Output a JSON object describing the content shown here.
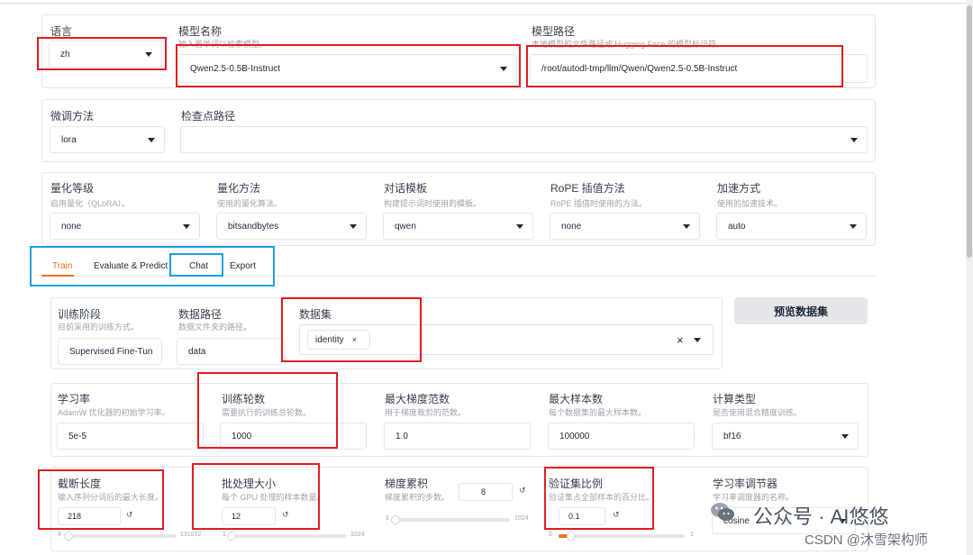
{
  "top": {
    "lang": {
      "label": "语言",
      "value": "zh"
    },
    "model_name": {
      "label": "模型名称",
      "hint": "输入首单词以检索模型。",
      "value": "Qwen2.5-0.5B-Instruct"
    },
    "model_path": {
      "label": "模型路径",
      "hint": "本地模型的文件路径或 Hugging Face 的模型标识符。",
      "value": "/root/autodl-tmp/llm/Qwen/Qwen2.5-0.5B-Instruct"
    }
  },
  "finetune": {
    "method": {
      "label": "微调方法",
      "value": "lora"
    },
    "checkpoint": {
      "label": "检查点路径",
      "value": ""
    }
  },
  "advanced": {
    "quant_bit": {
      "label": "量化等级",
      "hint": "启用量化（QLoRA）。",
      "value": "none"
    },
    "quant_method": {
      "label": "量化方法",
      "hint": "使用的量化算法。",
      "value": "bitsandbytes"
    },
    "template": {
      "label": "对话模板",
      "hint": "构建提示词时使用的模板。",
      "value": "qwen"
    },
    "rope": {
      "label": "RoPE 插值方法",
      "hint": "RoPE 插值时使用的方法。",
      "value": "none"
    },
    "booster": {
      "label": "加速方式",
      "hint": "使用的加速技术。",
      "value": "auto"
    }
  },
  "tabs": [
    "Train",
    "Evaluate & Predict",
    "Chat",
    "Export"
  ],
  "train": {
    "stage": {
      "label": "训练阶段",
      "hint": "目前采用的训练方式。",
      "value": "Supervised Fine-Tun"
    },
    "data_dir": {
      "label": "数据路径",
      "hint": "数据文件夹的路径。",
      "value": "data"
    },
    "dataset": {
      "label": "数据集",
      "chip": "identity",
      "chip_close": "×",
      "clear": "×"
    },
    "preview_button": "预览数据集",
    "learning_rate": {
      "label": "学习率",
      "hint": "AdamW 优化器的初始学习率。",
      "value": "5e-5"
    },
    "epochs": {
      "label": "训练轮数",
      "hint": "需要执行的训练总轮数。",
      "value": "1000"
    },
    "max_grad_norm": {
      "label": "最大梯度范数",
      "hint": "用于梯度裁剪的范数。",
      "value": "1.0"
    },
    "max_samples": {
      "label": "最大样本数",
      "hint": "每个数据集的最大样本数。",
      "value": "100000"
    },
    "compute_type": {
      "label": "计算类型",
      "hint": "是否使用混合精度训练。",
      "value": "bf16"
    },
    "cutoff_len": {
      "label": "截断长度",
      "hint": "输入序列分词后的最大长度。",
      "value": "218",
      "min": "4",
      "max": "131072",
      "fraction": 0.002
    },
    "batch_size": {
      "label": "批处理大小",
      "hint": "每个 GPU 处理的样本数量。",
      "value": "12",
      "min": "1",
      "max": "1024",
      "fraction": 0.011
    },
    "grad_accum": {
      "label": "梯度累积",
      "hint": "梯度累积的步数。",
      "value": "8",
      "min": "1",
      "max": "1024",
      "fraction": 0.007
    },
    "val_size": {
      "label": "验证集比例",
      "hint": "验证集占全部样本的百分比。",
      "value": "0.1",
      "min": "0",
      "max": "1",
      "fraction": 0.1
    },
    "lr_scheduler": {
      "label": "学习率调节器",
      "hint": "学习率调度器的名称。",
      "value": "cosine"
    }
  },
  "reset_icon": "↺",
  "watermark": {
    "main": "公众号 · AI悠悠",
    "sub": "CSDN @沐雪架构师"
  },
  "colors": {
    "accent": "#f97316",
    "annotation_red": "#e11d1d",
    "annotation_blue": "#1e9fe0"
  }
}
